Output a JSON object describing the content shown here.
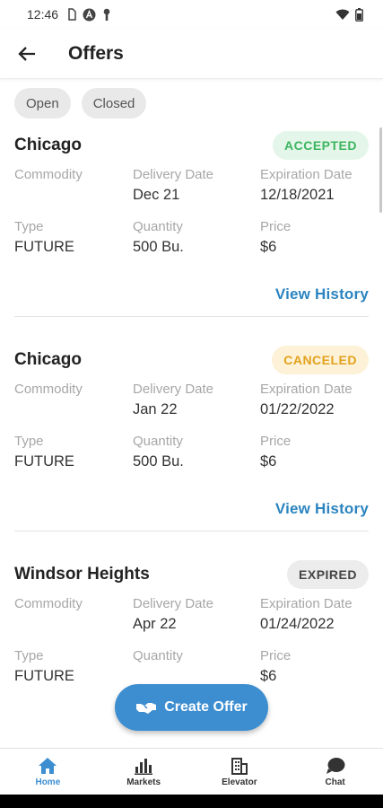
{
  "status": {
    "time": "12:46"
  },
  "appbar": {
    "title": "Offers"
  },
  "filters": [
    {
      "label": "Open"
    },
    {
      "label": "Closed"
    }
  ],
  "labels": {
    "commodity": "Commodity",
    "delivery_date": "Delivery Date",
    "expiration_date": "Expiration Date",
    "type": "Type",
    "quantity": "Quantity",
    "price": "Price",
    "view_history": "View History"
  },
  "offers": [
    {
      "city": "Chicago",
      "status": "ACCEPTED",
      "commodity": "",
      "delivery_date": "Dec 21",
      "expiration_date": "12/18/2021",
      "type": "FUTURE",
      "quantity": "500 Bu.",
      "price": "$6"
    },
    {
      "city": "Chicago",
      "status": "CANCELED",
      "commodity": "",
      "delivery_date": "Jan 22",
      "expiration_date": "01/22/2022",
      "type": "FUTURE",
      "quantity": "500 Bu.",
      "price": "$6"
    },
    {
      "city": "Windsor Heights",
      "status": "EXPIRED",
      "commodity": "",
      "delivery_date": "Apr 22",
      "expiration_date": "01/24/2022",
      "type": "FUTURE",
      "quantity": "",
      "price": "$6"
    }
  ],
  "fab": {
    "label": "Create Offer"
  },
  "nav": [
    {
      "label": "Home",
      "icon": "home-icon",
      "active": true
    },
    {
      "label": "Markets",
      "icon": "bar-chart-icon",
      "active": false
    },
    {
      "label": "Elevator",
      "icon": "building-icon",
      "active": false
    },
    {
      "label": "Chat",
      "icon": "chat-bubble-icon",
      "active": false
    }
  ],
  "colors": {
    "accent": "#3d8ed1",
    "accepted": "#3cb55f",
    "canceled": "#e2a21d",
    "expired": "#444444"
  }
}
